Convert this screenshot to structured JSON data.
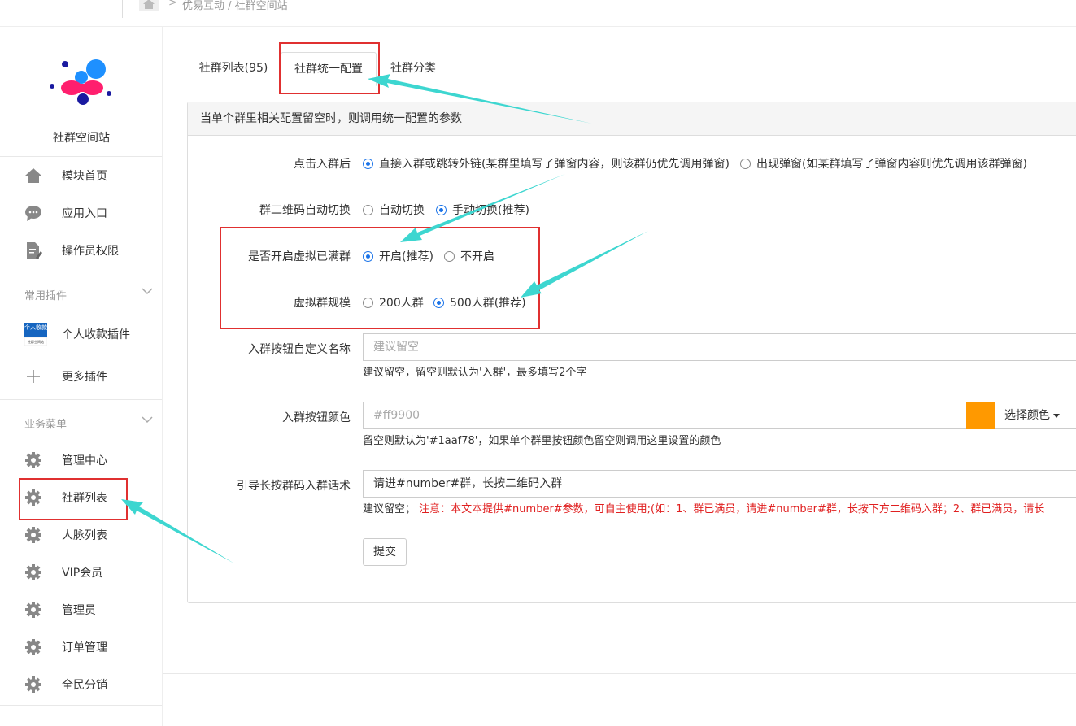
{
  "breadcrumb": {
    "separator": ">",
    "path": "优易互动 / 社群空间站"
  },
  "sidebar": {
    "site_name": "社群空间站",
    "top_items": [
      {
        "label": "模块首页",
        "icon": "home-icon"
      },
      {
        "label": "应用入口",
        "icon": "chat-bubble-icon"
      },
      {
        "label": "操作员权限",
        "icon": "document-edit-icon"
      }
    ],
    "groups": [
      {
        "title": "常用插件",
        "items": [
          {
            "label": "个人收款插件",
            "icon": "payment-plugin-icon",
            "icon_text": "个人收款",
            "icon_subtext": "社群空间站"
          },
          {
            "label": "更多插件",
            "icon": "plus-icon"
          }
        ]
      },
      {
        "title": "业务菜单",
        "items": [
          {
            "label": "管理中心",
            "icon": "gear-icon"
          },
          {
            "label": "社群列表",
            "icon": "gear-icon"
          },
          {
            "label": "人脉列表",
            "icon": "gear-icon"
          },
          {
            "label": "VIP会员",
            "icon": "gear-icon"
          },
          {
            "label": "管理员",
            "icon": "gear-icon"
          },
          {
            "label": "订单管理",
            "icon": "gear-icon"
          },
          {
            "label": "全民分销",
            "icon": "gear-icon"
          }
        ]
      }
    ]
  },
  "tabs": [
    {
      "label": "社群列表(95)"
    },
    {
      "label": "社群统一配置",
      "active": true
    },
    {
      "label": "社群分类"
    }
  ],
  "panel": {
    "header": "当单个群里相关配置留空时，则调用统一配置的参数",
    "click_join": {
      "label": "点击入群后",
      "options": [
        "直接入群或跳转外链(某群里填写了弹窗内容，则该群仍优先调用弹窗)",
        "出现弹窗(如某群填写了弹窗内容则优先调用该群弹窗)"
      ],
      "selected": 0
    },
    "qr_switch": {
      "label": "群二维码自动切换",
      "options": [
        "自动切换",
        "手动切换(推荐)"
      ],
      "selected": 1
    },
    "virtual_full": {
      "label": "是否开启虚拟已满群",
      "options": [
        "开启(推荐)",
        "不开启"
      ],
      "selected": 0
    },
    "virtual_size": {
      "label": "虚拟群规模",
      "options": [
        "200人群",
        "500人群(推荐)"
      ],
      "selected": 1
    },
    "button_name": {
      "label": "入群按钮自定义名称",
      "placeholder": "建议留空",
      "help": "建议留空，留空则默认为'入群'，最多填写2个字"
    },
    "button_color": {
      "label": "入群按钮颜色",
      "value": "#ff9900",
      "swatch": "#ff9900",
      "picker_label": "选择颜色",
      "help": "留空则默认为'#1aaf78'，如果单个群里按钮颜色留空则调用这里设置的颜色"
    },
    "guide_text": {
      "label": "引导长按群码入群话术",
      "value": "请进#number#群，长按二维码入群",
      "help_prefix": "建议留空；",
      "help_red": "注意：本文本提供#number#参数，可自主使用;(如：1、群已满员，请进#number#群，长按下方二维码入群；2、群已满员，请长"
    },
    "submit_label": "提交"
  },
  "colors": {
    "accent": "#1a73e8",
    "annotation_box": "#e03030",
    "annotation_arrow": "#3dd6d0"
  }
}
